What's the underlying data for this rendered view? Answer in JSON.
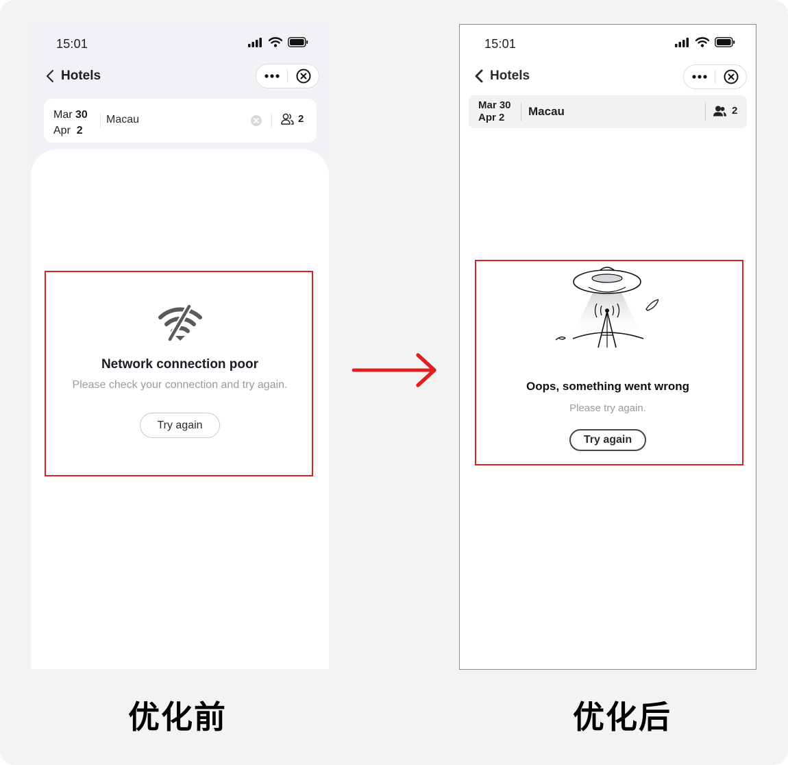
{
  "before": {
    "status": {
      "time": "15:01"
    },
    "nav": {
      "title": "Hotels"
    },
    "search": {
      "checkin_month": "Mar",
      "checkin_day": "30",
      "checkout_month": "Apr",
      "checkout_day": "2",
      "city": "Macau",
      "guests": "2"
    },
    "error": {
      "title": "Network connection poor",
      "subtitle": "Please check your connection and try again.",
      "button": "Try again"
    },
    "caption": "优化前"
  },
  "after": {
    "status": {
      "time": "15:01"
    },
    "nav": {
      "title": "Hotels"
    },
    "search": {
      "checkin": "Mar 30",
      "checkout": "Apr 2",
      "city": "Macau",
      "guests": "2"
    },
    "error": {
      "title": "Oops, something went wrong",
      "subtitle": "Please try again.",
      "button": "Try again"
    },
    "caption": "优化后"
  },
  "colors": {
    "highlight": "#e02020",
    "arrow": "#e02020"
  },
  "icons": [
    "signal-icon",
    "wifi-icon",
    "battery-icon",
    "back-chevron-icon",
    "more-icon",
    "close-icon",
    "clear-icon",
    "guests-icon",
    "no-wifi-icon",
    "antenna-illustration"
  ]
}
